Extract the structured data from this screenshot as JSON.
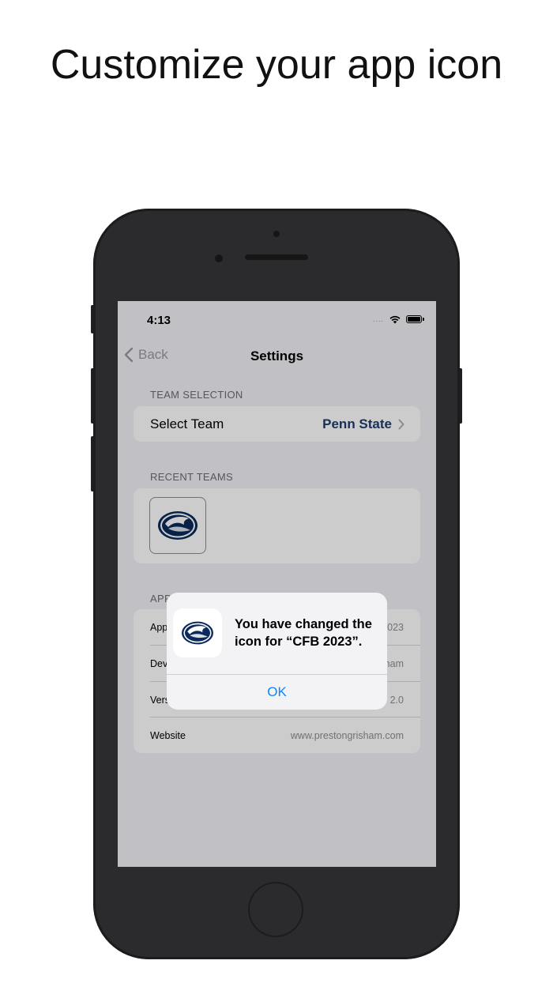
{
  "headline": "Customize your app icon",
  "status_bar": {
    "time": "4:13",
    "signal": "....",
    "wifi_icon": "wifi-icon",
    "battery_icon": "battery-icon"
  },
  "nav": {
    "back_label": "Back",
    "title": "Settings"
  },
  "team_selection": {
    "header": "TEAM SELECTION",
    "row_label": "Select Team",
    "row_value": "Penn State"
  },
  "recent_teams": {
    "header": "RECENT TEAMS",
    "tiles": [
      "penn-state-logo"
    ]
  },
  "app_info": {
    "header": "APP",
    "rows": [
      {
        "label": "App",
        "value": "2023"
      },
      {
        "label": "Dev",
        "value": "ham"
      },
      {
        "label": "Vers",
        "value": "2.0"
      },
      {
        "label": "Website",
        "value": "www.prestongrisham.com"
      }
    ]
  },
  "alert": {
    "message": "You have changed the icon for “CFB 2023”.",
    "ok_label": "OK"
  },
  "colors": {
    "accent_blue": "#0a84ff",
    "team_navy": "#1f3b6e",
    "phone_body": "#2b2b2d"
  }
}
